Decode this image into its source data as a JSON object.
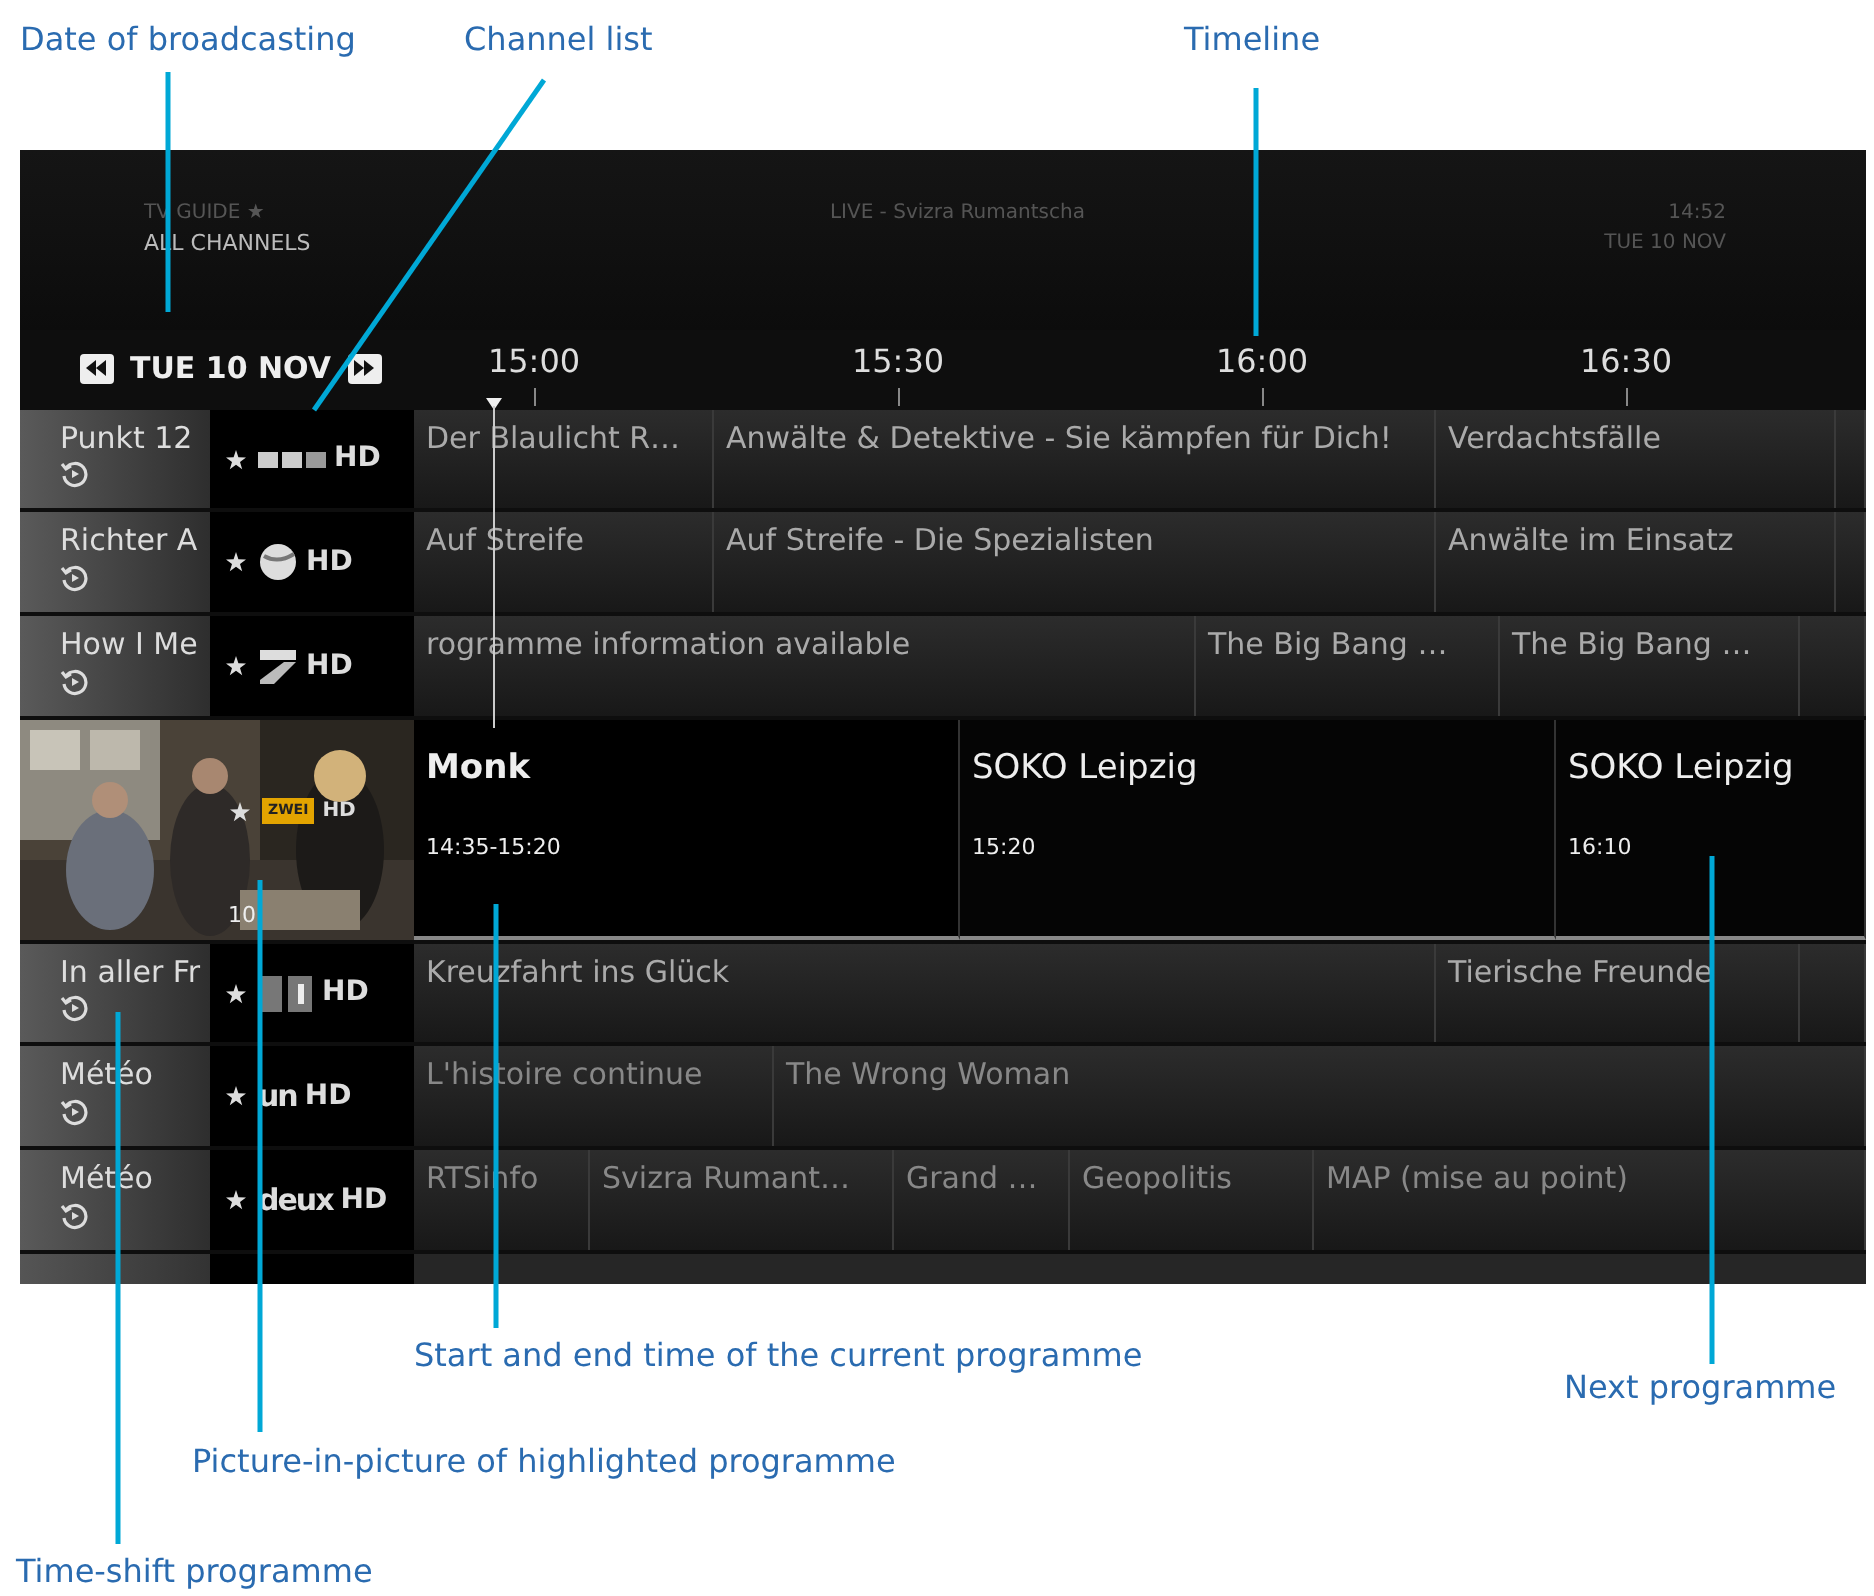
{
  "callouts": [
    {
      "label": "Date of broadcasting"
    },
    {
      "label": "Channel list"
    },
    {
      "label": "Timeline"
    },
    {
      "label": "Start and end time of the current programme"
    },
    {
      "label": "Next programme"
    },
    {
      "label": "Picture-in-picture of highlighted programme"
    },
    {
      "label": "Time-shift programme"
    }
  ],
  "header": {
    "title": "TV GUIDE ★",
    "subtitle": "ALL CHANNELS",
    "now_playing": "LIVE - Svizra Rumantscha",
    "clock": "14:52",
    "date": "TUE 10 NOV"
  },
  "timeline": {
    "date": "TUE 10 NOV",
    "times": [
      "15:00",
      "15:30",
      "16:00",
      "16:30"
    ]
  },
  "rows": [
    {
      "channel": "Punkt 12",
      "timeshift": true,
      "favourite": true,
      "selected": false,
      "logo": {
        "kind": "blocks",
        "label": "HD"
      },
      "programmes": [
        {
          "title": "Der Blaulicht R…"
        },
        {
          "title": "Anwälte & Detektive - Sie kämpfen für Dich!"
        },
        {
          "title": "Verdachtsfälle"
        }
      ]
    },
    {
      "channel": "Richter A",
      "timeshift": true,
      "favourite": true,
      "selected": false,
      "logo": {
        "kind": "ball",
        "label": "HD"
      },
      "programmes": [
        {
          "title": "Auf Streife"
        },
        {
          "title": "Auf Streife - Die Spezialisten"
        },
        {
          "title": "Anwälte im Einsatz"
        }
      ]
    },
    {
      "channel": "How I Me",
      "timeshift": true,
      "favourite": true,
      "selected": false,
      "logo": {
        "kind": "seven",
        "label": "HD"
      },
      "programmes": [
        {
          "title": "rogramme information available"
        },
        {
          "title": "The Big Bang …"
        },
        {
          "title": "The Big Bang …"
        }
      ]
    },
    {
      "number": "10",
      "favourite": true,
      "selected": true,
      "logo": {
        "kind": "badge",
        "mark": "ZWEI",
        "label": "HD"
      },
      "programmes": [
        {
          "title": "Monk",
          "time": "14:35-15:20"
        },
        {
          "title": "SOKO Leipzig",
          "time": "15:20"
        },
        {
          "title": "SOKO Leipzig",
          "time": "16:10"
        }
      ]
    },
    {
      "channel": "In aller Fr",
      "timeshift": true,
      "favourite": true,
      "selected": false,
      "logo": {
        "kind": "squares",
        "label": "HD"
      },
      "programmes": [
        {
          "title": "Kreuzfahrt ins Glück"
        },
        {
          "title": "Tierische Freunde"
        }
      ]
    },
    {
      "channel": "Météo",
      "timeshift": true,
      "favourite": true,
      "selected": false,
      "logo": {
        "kind": "wordmark",
        "mark": "un",
        "label": "HD"
      },
      "programmes": [
        {
          "title": "L'histoire continue"
        },
        {
          "title": "The Wrong Woman"
        }
      ]
    },
    {
      "channel": "Météo",
      "timeshift": true,
      "favourite": true,
      "selected": false,
      "logo": {
        "kind": "wordmark",
        "mark": "deux",
        "label": "HD"
      },
      "programmes": [
        {
          "title": "RTSinfo"
        },
        {
          "title": "Svizra Rumant…"
        },
        {
          "title": "Grand …"
        },
        {
          "title": "Geopolitis"
        },
        {
          "title": "MAP (mise au point)"
        }
      ]
    }
  ]
}
